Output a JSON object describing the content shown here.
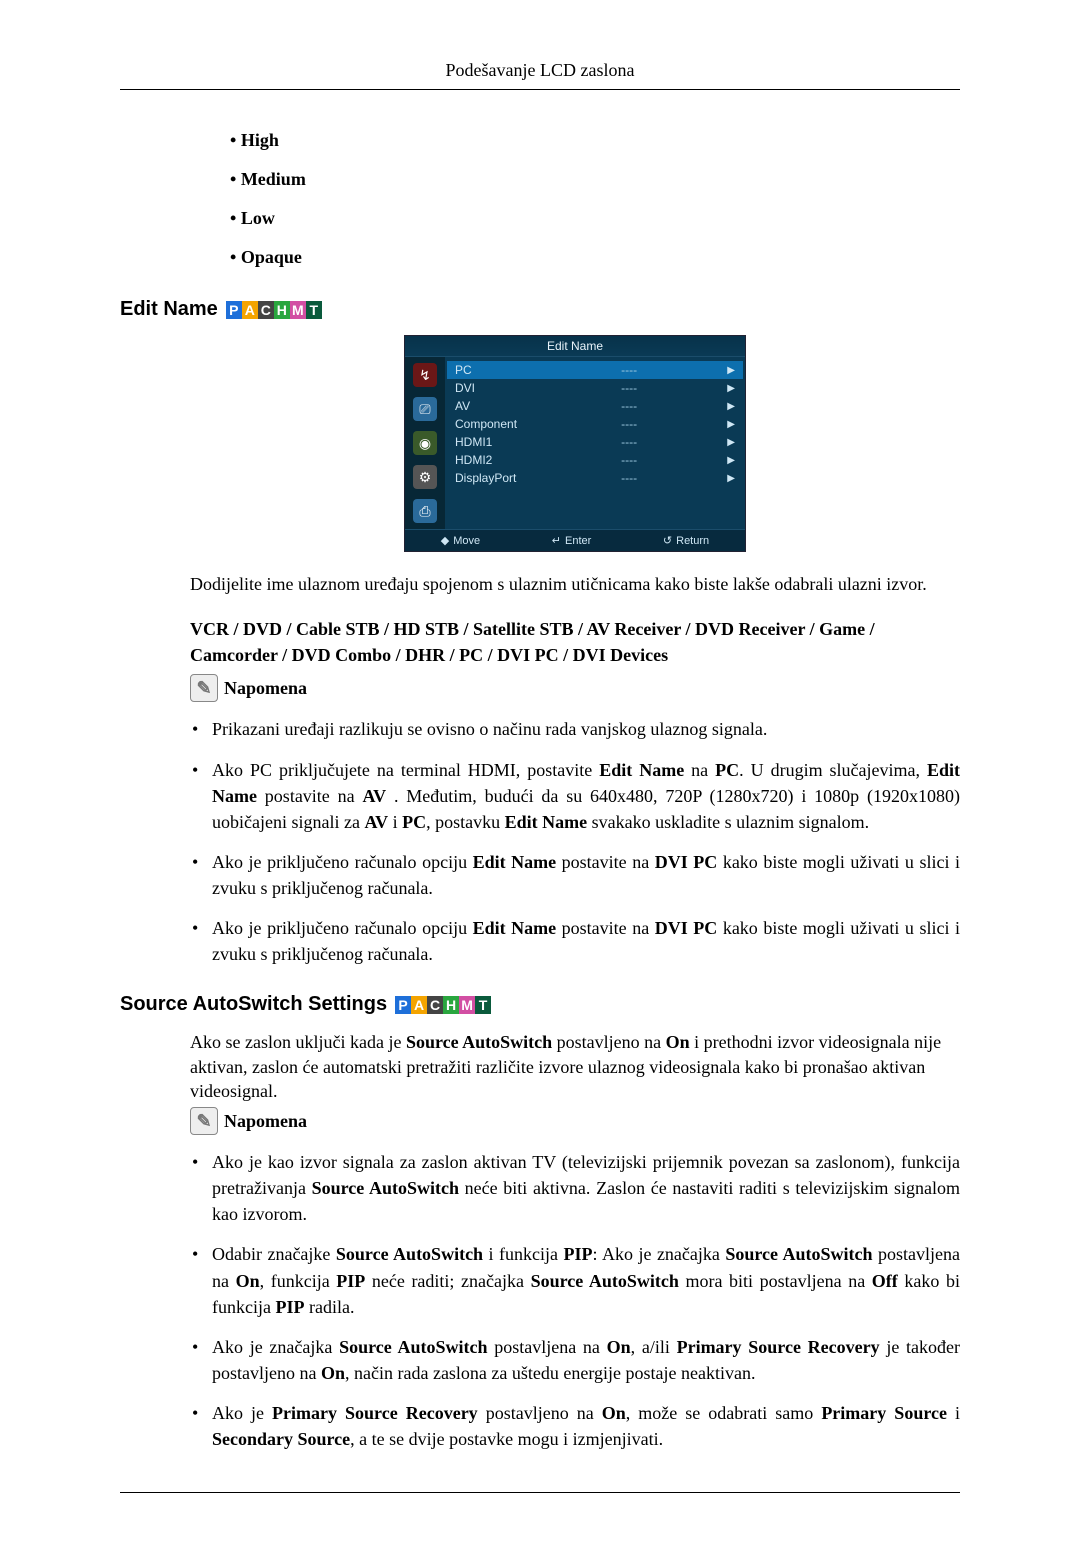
{
  "header": "Podešavanje LCD zaslona",
  "first_list": [
    "High",
    "Medium",
    "Low",
    "Opaque"
  ],
  "section1": {
    "title": "Edit Name",
    "pachmt": [
      "P",
      "A",
      "C",
      "H",
      "M",
      "T"
    ]
  },
  "osd": {
    "title": "Edit Name",
    "icons": [
      "↯",
      "⎚",
      "◉",
      "⚙",
      "⎙"
    ],
    "rows": [
      {
        "lab": "PC",
        "val": "----",
        "sel": true
      },
      {
        "lab": "DVI",
        "val": "----"
      },
      {
        "lab": "AV",
        "val": "----"
      },
      {
        "lab": "Component",
        "val": "----"
      },
      {
        "lab": "HDMI1",
        "val": "----"
      },
      {
        "lab": "HDMI2",
        "val": "----"
      },
      {
        "lab": "DisplayPort",
        "val": "----"
      }
    ],
    "foot": {
      "move": "Move",
      "enter": "Enter",
      "return": "Return"
    }
  },
  "p1": "Dodijelite ime ulaznom uređaju spojenom s ulaznim utičnicama kako biste lakše odabrali ulazni izvor.",
  "bold_block": "VCR / DVD / Cable STB / HD STB / Satellite STB / AV Receiver / DVD Receiver / Game / Camcorder / DVD Combo / DHR / PC / DVI PC / DVI Devices",
  "note_label": "Napomena",
  "notes1": {
    "b1": "Prikazani uređaji razlikuju se ovisno o načinu rada vanjskog ulaznog signala.",
    "b2_a": "Ako PC priključujete na terminal HDMI, postavite ",
    "b2_editname": "Edit Name",
    "b2_b": " na ",
    "b2_pc": "PC",
    "b2_c": ". U drugim slučajevima, ",
    "b2_editname2": "Edit Name",
    "b2_d": " postavite na ",
    "b2_av": "AV",
    "b2_e": " . Međutim, budući da su 640x480, 720P (1280x720) i 1080p (1920x1080) uobičajeni signali za ",
    "b2_av2": "AV",
    "b2_f": " i ",
    "b2_pc2": "PC",
    "b2_g": ", postavku ",
    "b2_editname3": "Edit Name",
    "b2_h": " svakako uskladite s ulaznim signalom.",
    "b3_a": "Ako je priključeno računalo opciju ",
    "b3_b": " postavite na ",
    "b3_dvipc": "DVI PC",
    "b3_c": " kako biste mogli uživati u slici i zvuku s priključenog računala."
  },
  "section2": {
    "title": "Source AutoSwitch Settings"
  },
  "p2_a": "Ako se zaslon uključi kada je ",
  "p2_sas": "Source AutoSwitch",
  "p2_b": " postavljeno na ",
  "p2_on": "On",
  "p2_c": " i prethodni izvor videosignala nije aktivan, zaslon će automatski pretražiti različite izvore ulaznog videosignala kako bi pronašao aktivan videosignal.",
  "notes2": {
    "b1_a": "Ako je kao izvor signala za zaslon aktivan TV (televizijski prijemnik povezan sa zaslonom), funkcija pretraživanja ",
    "b1_b": " neće biti aktivna. Zaslon će nastaviti raditi s televizijskim signalom kao izvorom.",
    "b2_a": "Odabir značajke ",
    "b2_b": " i funkcija ",
    "b2_pip": "PIP",
    "b2_c": ": Ako je značajka ",
    "b2_d": " postavljena na ",
    "b2_e": ", funkcija ",
    "b2_f": " neće raditi; značajka ",
    "b2_g": " mora biti postavljena na ",
    "b2_off": "Off",
    "b2_h": " kako bi funkcija ",
    "b2_i": " radila.",
    "b3_a": "Ako je značajka ",
    "b3_b": " postavljena na ",
    "b3_c": ", a/ili ",
    "b3_psr": "Primary Source Recovery",
    "b3_d": " je također postavljeno na ",
    "b3_e": ", način rada zaslona za uštedu energije postaje neaktivan.",
    "b4_a": "Ako je ",
    "b4_b": " postavljeno na ",
    "b4_c": ", može se odabrati samo ",
    "b4_ps": "Primary Source",
    "b4_d": " i ",
    "b4_ss": "Secondary Source",
    "b4_e": ", a te se dvije postavke mogu i izmjenjivati."
  }
}
